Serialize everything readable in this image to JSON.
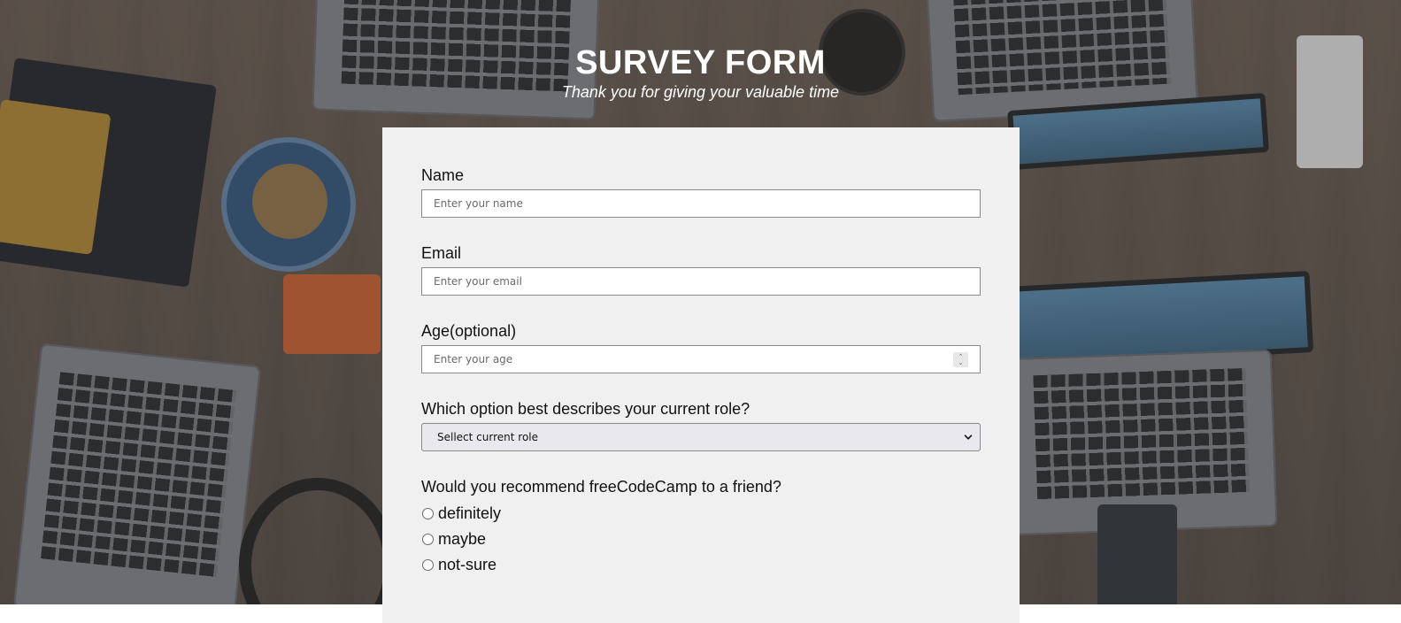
{
  "header": {
    "title": "SURVEY FORM",
    "subtitle": "Thank you for giving your valuable time"
  },
  "form": {
    "name": {
      "label": "Name",
      "placeholder": "Enter your name"
    },
    "email": {
      "label": "Email",
      "placeholder": "Enter your email"
    },
    "age": {
      "label": "Age(optional)",
      "placeholder": "Enter your age"
    },
    "role": {
      "label": "Which option best describes your current role?",
      "selected": "Sellect current role"
    },
    "recommend": {
      "label": "Would you recommend freeCodeCamp to a friend?",
      "options": [
        "definitely",
        "maybe",
        "not-sure"
      ]
    }
  },
  "colors": {
    "card_bg": "#f0f0f0",
    "header_text": "#ffffff"
  },
  "icons": {
    "select_arrow": "chevron-down-icon",
    "spinner": "number-spinner-icon"
  }
}
